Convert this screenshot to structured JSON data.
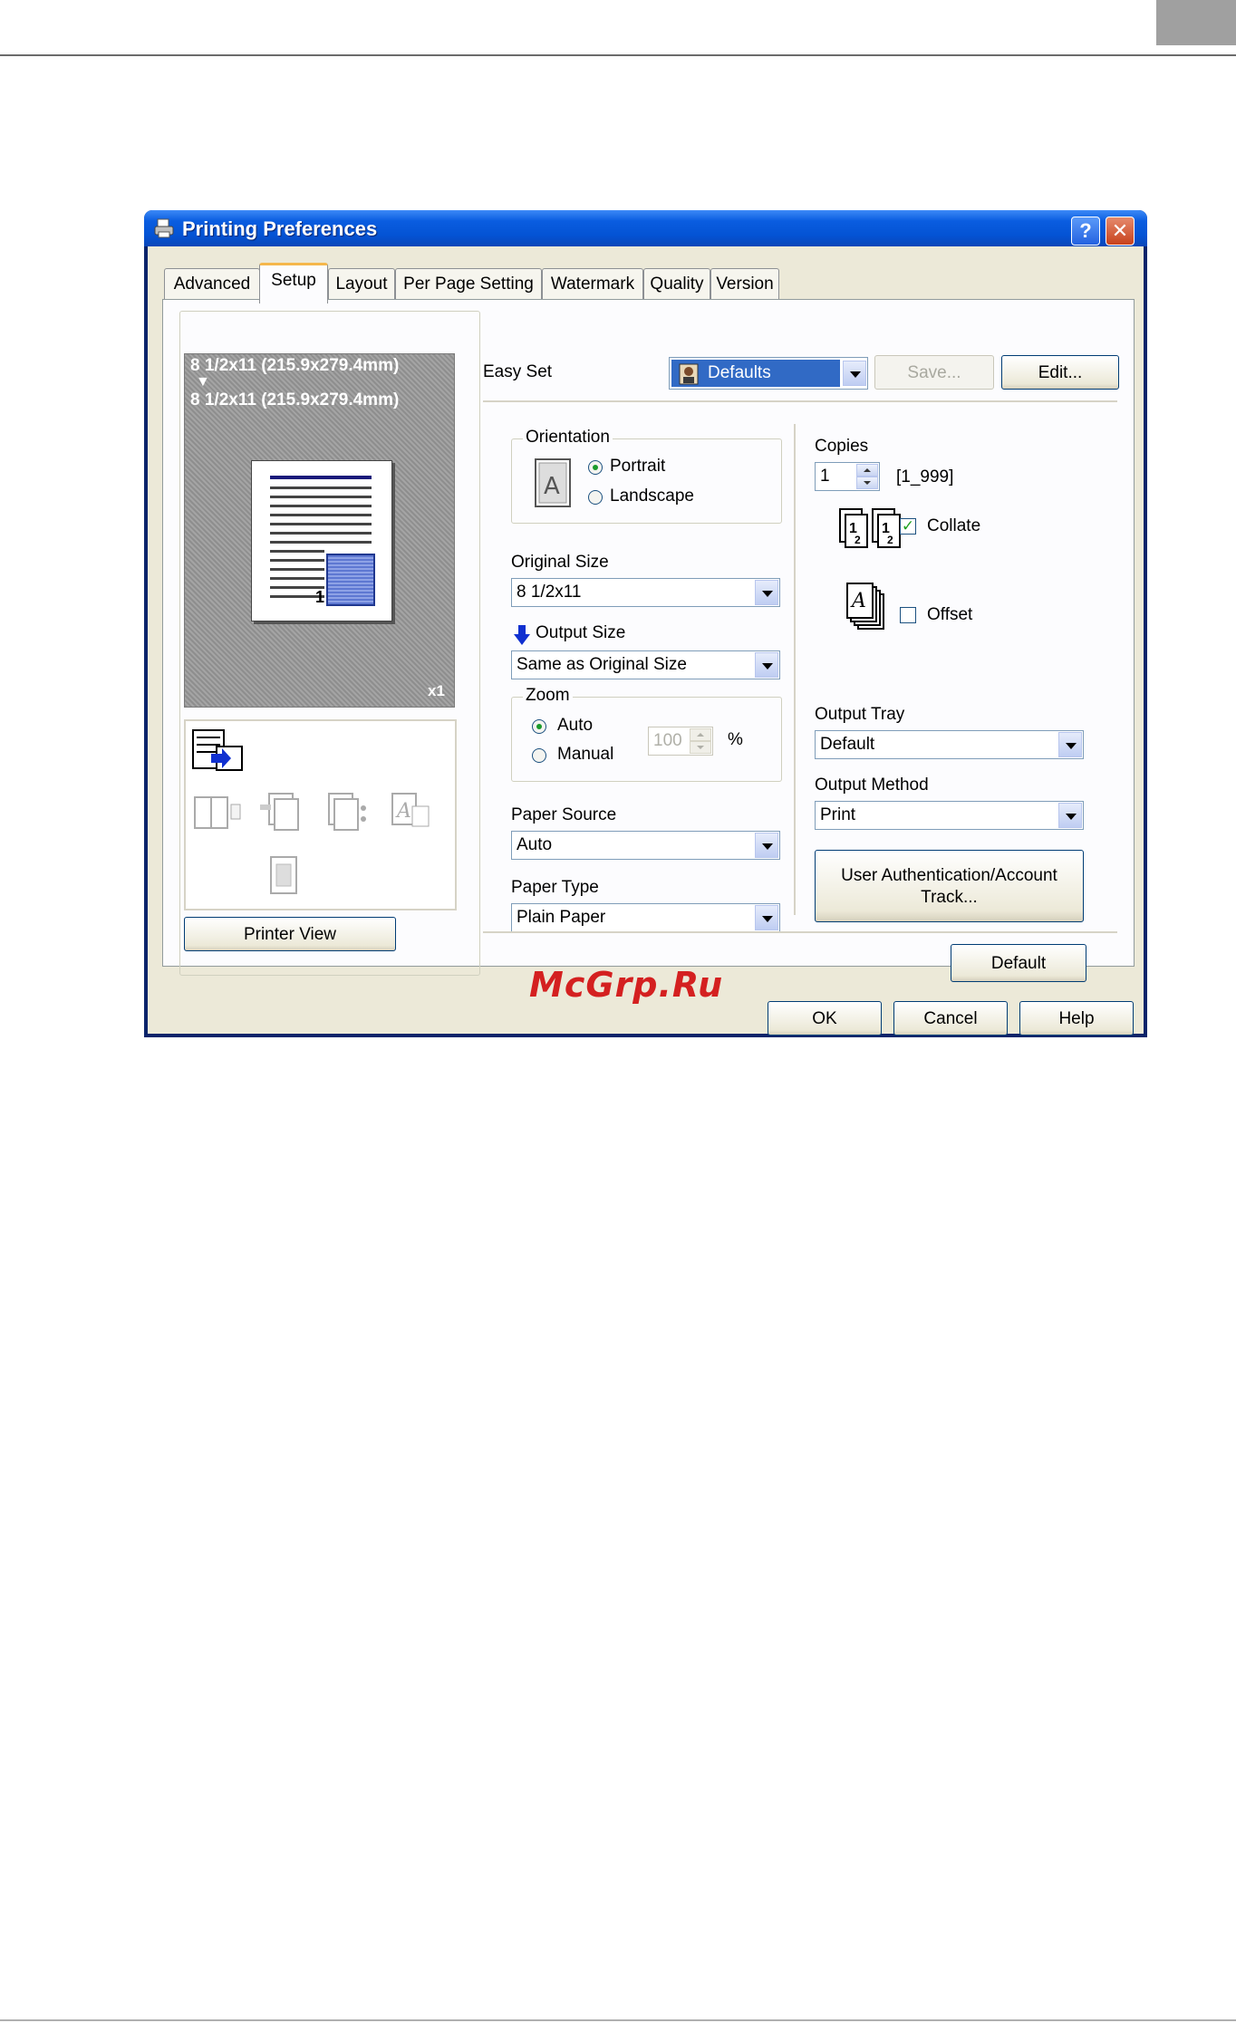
{
  "window": {
    "title": "Printing Preferences",
    "help_glyph": "?",
    "close_glyph": "✕"
  },
  "tabs": [
    "Advanced",
    "Setup",
    "Layout",
    "Per Page Setting",
    "Watermark",
    "Quality",
    "Version"
  ],
  "active_tab": "Setup",
  "preview": {
    "original_size": "8 1/2x11 (215.9x279.4mm)",
    "arrow": "▼",
    "output_size": "8 1/2x11 (215.9x279.4mm)",
    "page_number": "1",
    "copies_badge": "x1",
    "printer_view_button": "Printer View"
  },
  "easy_set": {
    "label": "Easy Set",
    "selected": "Defaults",
    "save_button": "Save...",
    "edit_button": "Edit..."
  },
  "orientation": {
    "group_label": "Orientation",
    "icon_letter": "A",
    "options": [
      "Portrait",
      "Landscape"
    ],
    "selected": "Portrait"
  },
  "original_size": {
    "label": "Original Size",
    "value": "8 1/2x11"
  },
  "output_size": {
    "label": "Output Size",
    "value": "Same as Original Size"
  },
  "zoom": {
    "group_label": "Zoom",
    "options": [
      "Auto",
      "Manual"
    ],
    "selected": "Auto",
    "value": "100",
    "unit": "%"
  },
  "paper_source": {
    "label": "Paper Source",
    "value": "Auto"
  },
  "paper_type": {
    "label": "Paper Type",
    "value": "Plain Paper"
  },
  "copies": {
    "label": "Copies",
    "value": "1",
    "range": "[1_999]",
    "collate_label": "Collate",
    "collate_checked": true,
    "offset_label": "Offset",
    "offset_checked": false
  },
  "output_tray": {
    "label": "Output Tray",
    "value": "Default"
  },
  "output_method": {
    "label": "Output Method",
    "value": "Print"
  },
  "user_auth_button": "User Authentication/Account Track...",
  "default_button": "Default",
  "footer": {
    "ok": "OK",
    "cancel": "Cancel",
    "help": "Help"
  },
  "watermark_text": "McGrp.Ru",
  "colors": {
    "title_bar": "#0453d4",
    "dialog_bg": "#ece9d8",
    "tab_active_highlight": "#f5b74c",
    "watermark": "#d42020"
  }
}
